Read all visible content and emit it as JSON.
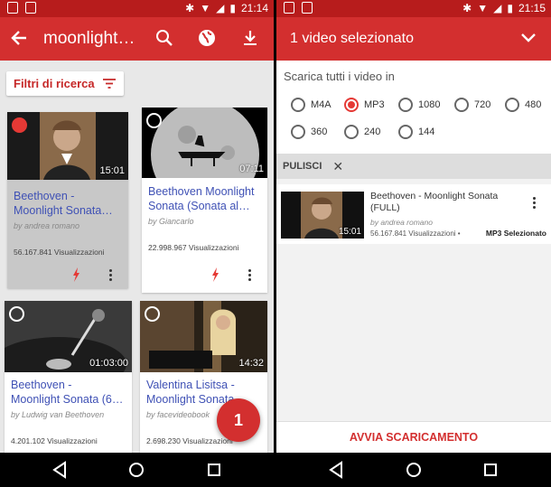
{
  "left": {
    "status": {
      "time": "21:14"
    },
    "appbar": {
      "search_query": "moonlight…"
    },
    "filter_label": "Filtri di ricerca",
    "cards": [
      {
        "title": "Beethoven -\nMoonlight Sonata…",
        "author": "by andrea romano",
        "views": "56.167.841 Visualizzazioni",
        "duration": "15:01",
        "selected": true
      },
      {
        "title": "Beethoven Moonlight\nSonata (Sonata al…",
        "author": "by Giancarlo",
        "views": "22.998.967 Visualizzazioni",
        "duration": "07:11",
        "selected": false
      },
      {
        "title": "Beethoven -\nMoonlight Sonata (6…",
        "author": "by Ludwig van Beethoven",
        "views": "4.201.102 Visualizzazioni",
        "duration": "01:03:00",
        "selected": false
      },
      {
        "title": "Valentina Lisitsa -\nMoonlight Sonata…",
        "author": "by facevideobook",
        "views": "2.698.230 Visualizzazioni",
        "duration": "14:32",
        "selected": false
      }
    ],
    "fab_count": "1"
  },
  "right": {
    "status": {
      "time": "21:15"
    },
    "appbar": {
      "title": "1 video selezionato"
    },
    "download_all_label": "Scarica tutti i video in",
    "formats": [
      "M4A",
      "MP3",
      "1080",
      "720",
      "480",
      "360",
      "240",
      "144"
    ],
    "selected_format": "MP3",
    "clear_label": "PULISCI",
    "selected_item": {
      "title": "Beethoven - Moonlight Sonata\n(FULL)",
      "author": "by andrea romano",
      "views": "56.167.841 Visualizzazioni •",
      "duration": "15:01",
      "badge": "MP3 Selezionato"
    },
    "start_button": "AVVIA SCARICAMENTO"
  },
  "colors": {
    "primary": "#d32f2f",
    "status": "#b71c1c",
    "link": "#3f51b5"
  }
}
